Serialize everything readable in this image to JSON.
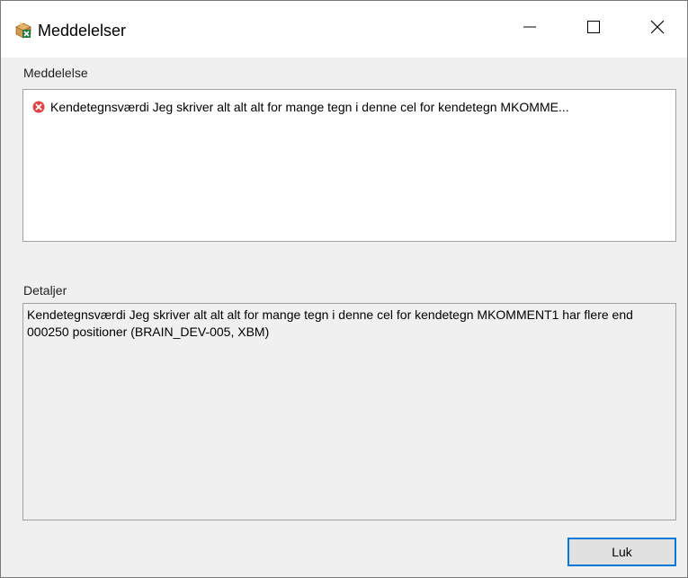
{
  "window": {
    "title": "Meddelelser",
    "icon": "excel-package-icon"
  },
  "titlebar_buttons": {
    "minimize_icon": "minimize-icon",
    "maximize_icon": "maximize-icon",
    "close_icon": "close-icon"
  },
  "message_section": {
    "label": "Meddelelse",
    "items": [
      {
        "icon": "error-icon",
        "text": "Kendetegnsværdi Jeg skriver alt alt alt for mange tegn i denne cel for kendetegn MKOMME..."
      }
    ]
  },
  "details_section": {
    "label": "Detaljer",
    "text": "Kendetegnsværdi Jeg skriver alt alt alt for mange tegn i denne cel for kendetegn MKOMMENT1 har flere end 000250 positioner (BRAIN_DEV-005, XBM)"
  },
  "buttons": {
    "close_label": "Luk"
  },
  "colors": {
    "window_bg": "#f0f0f0",
    "titlebar_bg": "#ffffff",
    "error_red": "#e04343",
    "focus_border": "#0078d7"
  }
}
